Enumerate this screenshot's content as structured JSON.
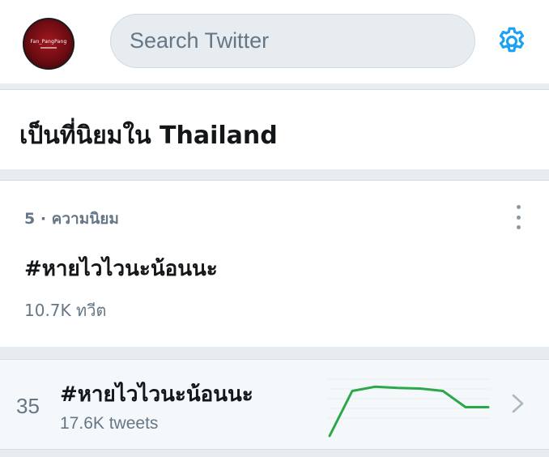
{
  "header": {
    "avatar_text": "Fan_PangPang",
    "search_placeholder": "Search Twitter",
    "settings_icon": "gear-icon",
    "accent_color": "#1da1f2"
  },
  "section": {
    "title": "เป็นที่นิยมใน Thailand"
  },
  "trend_card": {
    "meta": "5 · ความนิยม",
    "name": "#หายไวไวนะน้อนนะ",
    "count": "10.7K ทวีต",
    "more_icon": "more-vertical-icon"
  },
  "trend_row": {
    "rank": "35",
    "name": "#หายไวไวนะน้อนนะ",
    "count": "17.6K tweets",
    "chevron_icon": "chevron-right-icon",
    "line_color": "#2ba84a",
    "sparkline_values": [
      0,
      0.75,
      0.82,
      0.8,
      0.79,
      0.75,
      0.48,
      0.48
    ]
  }
}
